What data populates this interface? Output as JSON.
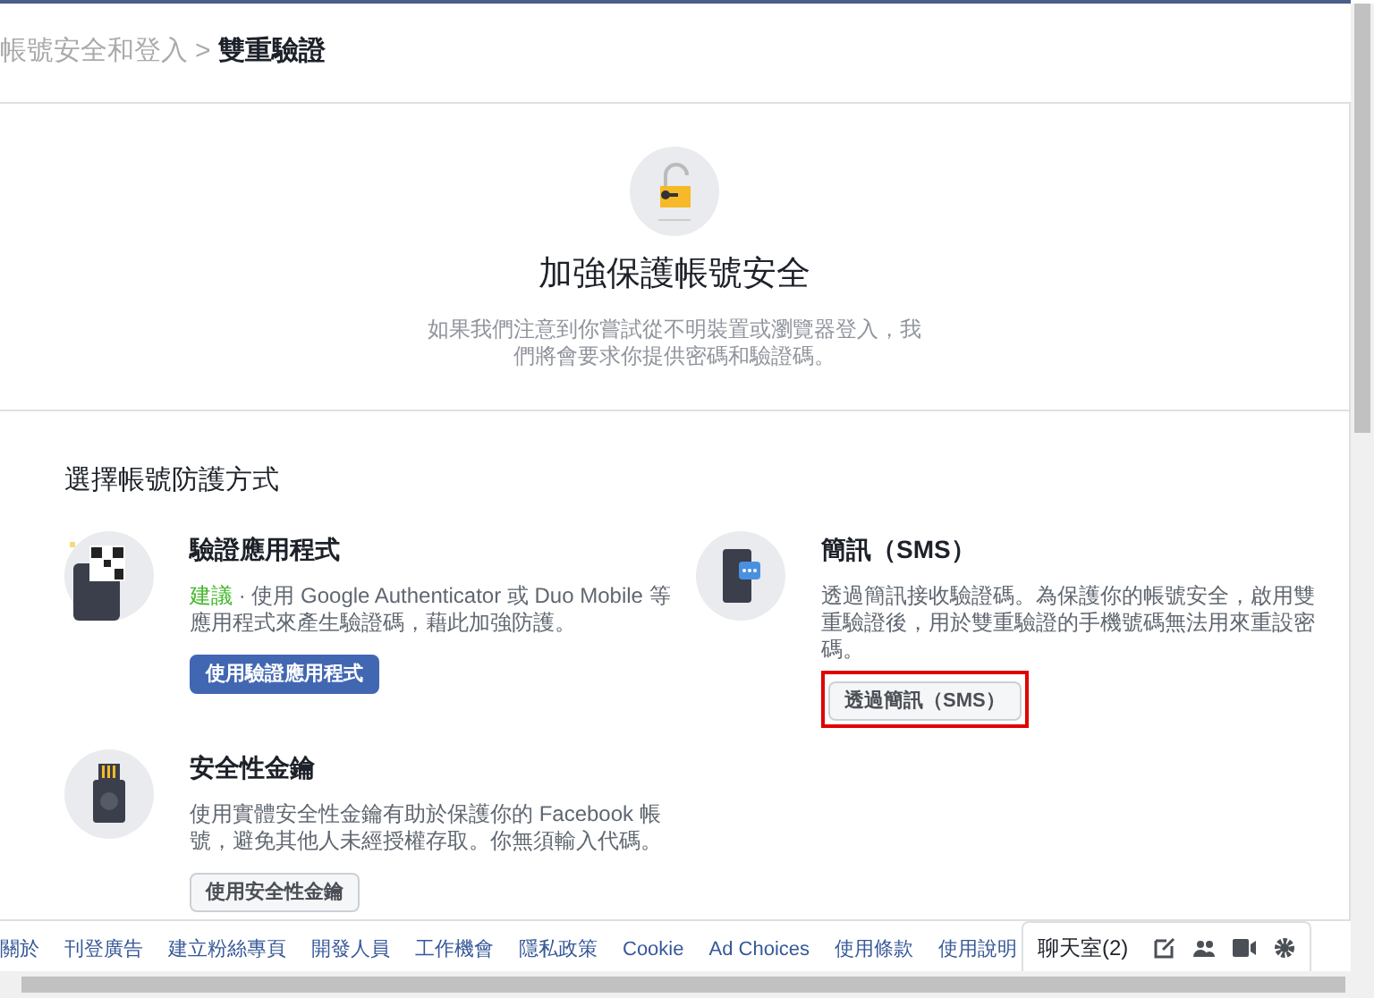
{
  "breadcrumb": {
    "parent": "帳號安全和登入",
    "separator": ">",
    "current": "雙重驗證"
  },
  "hero": {
    "title": "加強保護帳號安全",
    "description": "如果我們注意到你嘗試從不明裝置或瀏覽器登入，我們將會要求你提供密碼和驗證碼。"
  },
  "section_title": "選擇帳號防護方式",
  "methods": [
    {
      "kind": "app",
      "title": "驗證應用程式",
      "badge": "建議",
      "description": "· 使用 Google Authenticator 或 Duo Mobile 等應用程式來產生驗證碼，藉此加強防護。",
      "button": "使用驗證應用程式",
      "primary": true,
      "highlighted": false
    },
    {
      "kind": "sms",
      "title": "簡訊（SMS）",
      "description": "透過簡訊接收驗證碼。為保護你的帳號安全，啟用雙重驗證後，用於雙重驗證的手機號碼無法用來重設密碼。",
      "button": "透過簡訊（SMS）",
      "primary": false,
      "highlighted": true
    },
    {
      "kind": "key",
      "title": "安全性金鑰",
      "description": "使用實體安全性金鑰有助於保護你的 Facebook 帳號，避免其他人未經授權存取。你無須輸入代碼。",
      "button": "使用安全性金鑰",
      "primary": false,
      "highlighted": false
    }
  ],
  "footer_links": [
    "關於",
    "刊登廣告",
    "建立粉絲專頁",
    "開發人員",
    "工作機會",
    "隱私政策",
    "Cookie",
    "Ad Choices",
    "使用條款",
    "使用說明"
  ],
  "chat": {
    "label": "聊天室(2)"
  }
}
